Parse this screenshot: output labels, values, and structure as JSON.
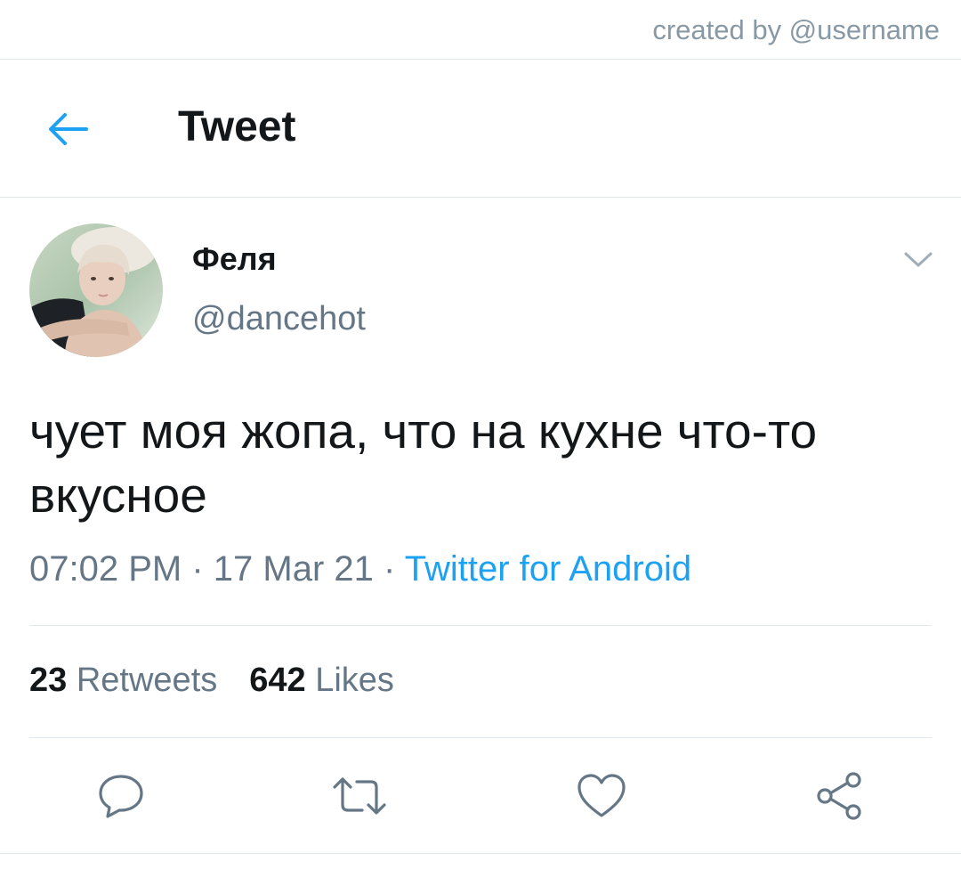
{
  "credit": "created by @username",
  "header": {
    "title": "Tweet",
    "back_icon": "arrow-left-icon"
  },
  "tweet": {
    "display_name": "Феля",
    "handle": "@dancehot",
    "text": "чует моя жопа, что на кухне что-то вкусное",
    "time": "07:02 PM",
    "date": "17 Mar 21",
    "source": "Twitter for Android",
    "separator": "·"
  },
  "stats": {
    "retweets_count": "23",
    "retweets_label": "Retweets",
    "likes_count": "642",
    "likes_label": "Likes"
  },
  "actions": {
    "reply_icon": "reply-icon",
    "retweet_icon": "retweet-icon",
    "like_icon": "heart-icon",
    "share_icon": "share-icon"
  },
  "colors": {
    "accent": "#1da1f2",
    "text_primary": "#14171a",
    "text_secondary": "#657786",
    "border": "#e1e8ed"
  }
}
